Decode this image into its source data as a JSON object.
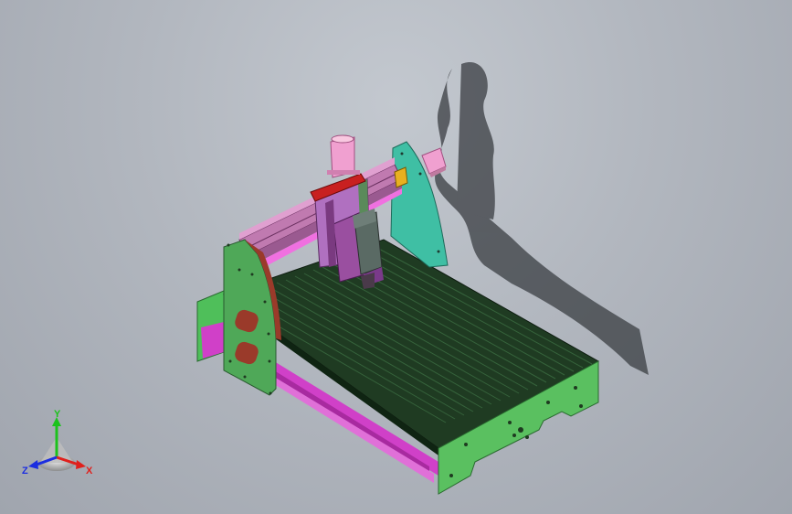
{
  "triad": {
    "x_label": "X",
    "y_label": "Y",
    "z_label": "Z",
    "colors": {
      "x": "#e0201c",
      "y": "#1cc21c",
      "z": "#1c2ee0"
    }
  },
  "colors": {
    "background": "#b2b7bf",
    "table_bed": "#1f3b22",
    "side_plate": "#4fbf5a",
    "gantry_plate_left": "#4faa5a",
    "gantry_plate_right": "#3fbfa4",
    "gantry_beam": "#c07ab0",
    "rail": "#e040d0",
    "z_carriage": "#9a4fa0",
    "spindle": "#5a6a64",
    "bracket": "#c82020",
    "motor": "#f0a0d0",
    "shadow": "#3a3d42"
  }
}
